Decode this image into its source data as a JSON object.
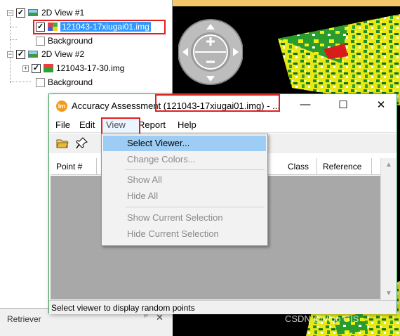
{
  "tree": {
    "items": [
      {
        "label": "2D View #1",
        "checked": true,
        "type": "view"
      },
      {
        "label": "121043-17xiugai01.img",
        "checked": true,
        "type": "image",
        "selected": true
      },
      {
        "label": "Background",
        "checked": false,
        "type": "background"
      },
      {
        "label": "2D View #2",
        "checked": true,
        "type": "view"
      },
      {
        "label": "121043-17-30.img",
        "checked": true,
        "type": "image"
      },
      {
        "label": "Background",
        "checked": false,
        "type": "background"
      }
    ]
  },
  "retriever": {
    "title": "Retriever",
    "pin_icon": "pin-icon",
    "close_icon": "close-icon"
  },
  "dialog": {
    "app_icon_text": "Im",
    "title": "Accuracy Assessment (121043-17xiugai01.img) - ...",
    "menu": [
      "File",
      "Edit",
      "View",
      "Report",
      "Help"
    ],
    "toolbar_icons": [
      "open-folder-icon",
      "pin-icon"
    ],
    "columns": [
      "Point #",
      "Class",
      "Reference"
    ],
    "status": "Select viewer to display random points"
  },
  "view_menu": {
    "items": [
      "Select Viewer...",
      "Change Colors...",
      "Show All",
      "Hide All",
      "Show Current Selection",
      "Hide Current Selection"
    ],
    "active_index": 0
  },
  "watermark": "CSDN @Vipo GIS",
  "colors": {
    "accent": "#3c9d55",
    "highlight": "#9dcdf5",
    "selection": "#3399ff",
    "annotation": "#e02020"
  }
}
